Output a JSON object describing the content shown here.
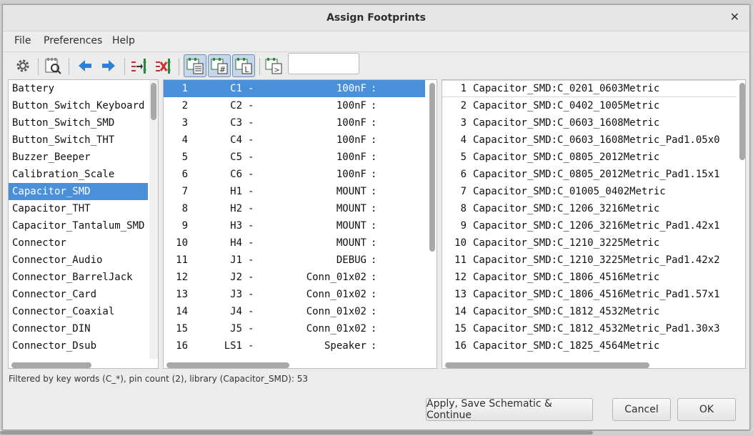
{
  "window": {
    "title": "Assign Footprints"
  },
  "menu": [
    "File",
    "Preferences",
    "Help"
  ],
  "toolbar": {
    "icons": [
      "settings-gear-icon",
      "view-footprint-icon",
      "previous-arrow-icon",
      "next-arrow-icon",
      "auto-associate-icon",
      "delete-associations-icon",
      "filter-keywords-icon",
      "filter-pincount-icon",
      "filter-library-icon",
      "filter-name-icon"
    ],
    "filter_value": ""
  },
  "libraries": {
    "items": [
      "Battery",
      "Button_Switch_Keyboard",
      "Button_Switch_SMD",
      "Button_Switch_THT",
      "Buzzer_Beeper",
      "Calibration_Scale",
      "Capacitor_SMD",
      "Capacitor_THT",
      "Capacitor_Tantalum_SMD",
      "Connector",
      "Connector_Audio",
      "Connector_BarrelJack",
      "Connector_Card",
      "Connector_Coaxial",
      "Connector_DIN",
      "Connector_Dsub"
    ],
    "selected": "Capacitor_SMD"
  },
  "components": {
    "rows": [
      {
        "num": "1",
        "ref": "C1",
        "value": "100nF"
      },
      {
        "num": "2",
        "ref": "C2",
        "value": "100nF"
      },
      {
        "num": "3",
        "ref": "C3",
        "value": "100nF"
      },
      {
        "num": "4",
        "ref": "C4",
        "value": "100nF"
      },
      {
        "num": "5",
        "ref": "C5",
        "value": "100nF"
      },
      {
        "num": "6",
        "ref": "C6",
        "value": "100nF"
      },
      {
        "num": "7",
        "ref": "H1",
        "value": "MOUNT"
      },
      {
        "num": "8",
        "ref": "H2",
        "value": "MOUNT"
      },
      {
        "num": "9",
        "ref": "H3",
        "value": "MOUNT"
      },
      {
        "num": "10",
        "ref": "H4",
        "value": "MOUNT"
      },
      {
        "num": "11",
        "ref": "J1",
        "value": "DEBUG"
      },
      {
        "num": "12",
        "ref": "J2",
        "value": "Conn_01x02"
      },
      {
        "num": "13",
        "ref": "J3",
        "value": "Conn_01x02"
      },
      {
        "num": "14",
        "ref": "J4",
        "value": "Conn_01x02"
      },
      {
        "num": "15",
        "ref": "J5",
        "value": "Conn_01x02"
      },
      {
        "num": "16",
        "ref": "LS1",
        "value": "Speaker"
      }
    ],
    "separator": "-",
    "suffix": ":",
    "selected_index": 0
  },
  "footprints": {
    "rows": [
      {
        "num": "1",
        "name": "Capacitor_SMD:C_0201_0603Metric"
      },
      {
        "num": "2",
        "name": "Capacitor_SMD:C_0402_1005Metric"
      },
      {
        "num": "3",
        "name": "Capacitor_SMD:C_0603_1608Metric"
      },
      {
        "num": "4",
        "name": "Capacitor_SMD:C_0603_1608Metric_Pad1.05x0"
      },
      {
        "num": "5",
        "name": "Capacitor_SMD:C_0805_2012Metric"
      },
      {
        "num": "6",
        "name": "Capacitor_SMD:C_0805_2012Metric_Pad1.15x1"
      },
      {
        "num": "7",
        "name": "Capacitor_SMD:C_01005_0402Metric"
      },
      {
        "num": "8",
        "name": "Capacitor_SMD:C_1206_3216Metric"
      },
      {
        "num": "9",
        "name": "Capacitor_SMD:C_1206_3216Metric_Pad1.42x1"
      },
      {
        "num": "10",
        "name": "Capacitor_SMD:C_1210_3225Metric"
      },
      {
        "num": "11",
        "name": "Capacitor_SMD:C_1210_3225Metric_Pad1.42x2"
      },
      {
        "num": "12",
        "name": "Capacitor_SMD:C_1806_4516Metric"
      },
      {
        "num": "13",
        "name": "Capacitor_SMD:C_1806_4516Metric_Pad1.57x1"
      },
      {
        "num": "14",
        "name": "Capacitor_SMD:C_1812_4532Metric"
      },
      {
        "num": "15",
        "name": "Capacitor_SMD:C_1812_4532Metric_Pad1.30x3"
      },
      {
        "num": "16",
        "name": "Capacitor_SMD:C_1825_4564Metric"
      }
    ]
  },
  "status": "Filtered by key words (C_*), pin count (2), library (Capacitor_SMD): 53",
  "buttons": {
    "apply": "Apply, Save Schematic & Continue",
    "cancel": "Cancel",
    "ok": "OK"
  },
  "colors": {
    "selection": "#4a90d9",
    "accent_blue": "#2f7fd6",
    "delete_red": "#d03030"
  }
}
